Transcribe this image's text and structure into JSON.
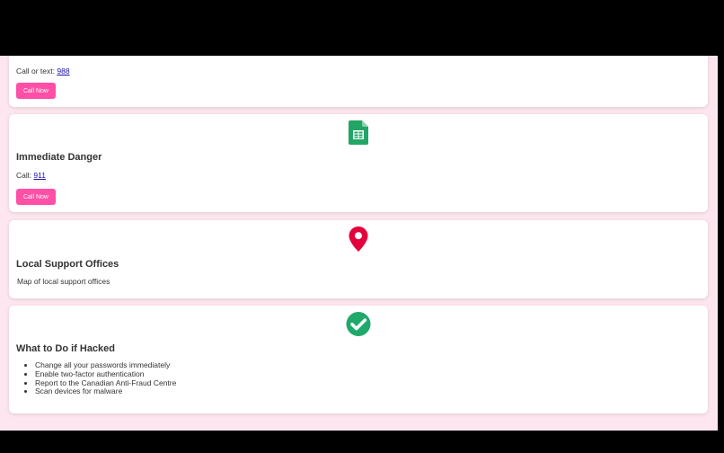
{
  "cards": {
    "crisis": {
      "contact_prefix": "Call or text: ",
      "number": "988",
      "button_label": "Call Now"
    },
    "danger": {
      "title": "Immediate Danger",
      "contact_prefix": "Call: ",
      "number": "911",
      "button_label": "Call Now",
      "icon": "spreadsheet-icon"
    },
    "offices": {
      "title": "Local Support Offices",
      "map_alt": "Map of local support offices",
      "icon": "map-pin-icon"
    },
    "hacked": {
      "title": "What to Do if Hacked",
      "icon": "checkmark-icon",
      "steps": [
        "Change all your passwords immediately",
        "Enable two-factor authentication",
        "Report to the Canadian Anti-Fraud Centre",
        "Scan devices for malware"
      ]
    }
  },
  "colors": {
    "page_background": "#fde6ef",
    "button": "#ff4fa6",
    "pin": "#e4003a",
    "check": "#1faa6b",
    "sheet": "#23a566"
  }
}
